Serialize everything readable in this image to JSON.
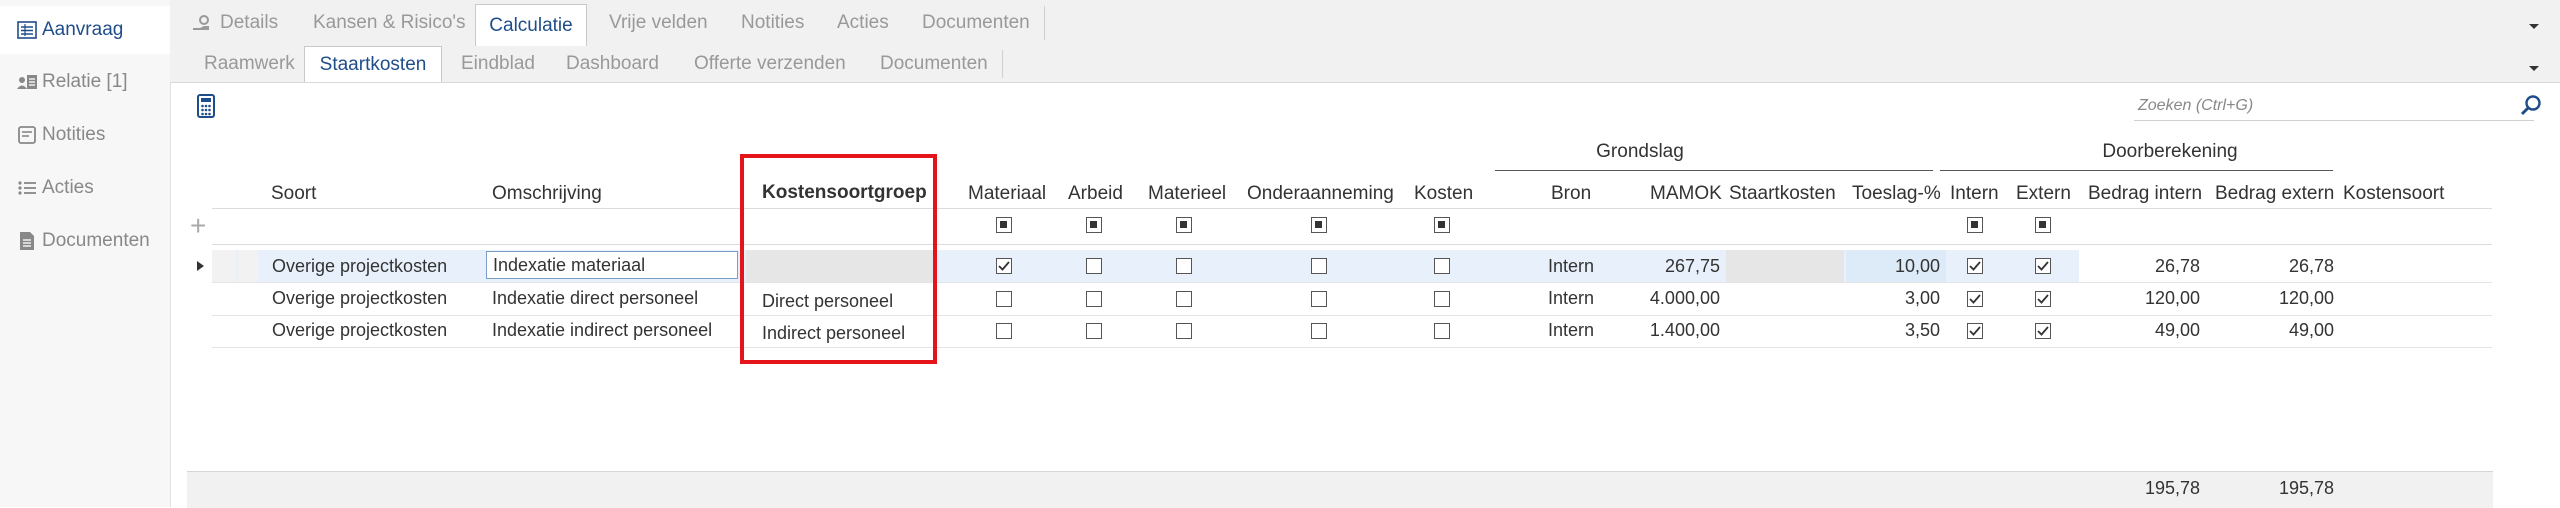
{
  "sidebar": {
    "items": [
      {
        "label": "Aanvraag",
        "icon": "form-icon",
        "active": true
      },
      {
        "label": "Relatie [1]",
        "icon": "contacts-icon",
        "active": false
      },
      {
        "label": "Notities",
        "icon": "notes-icon",
        "active": false
      },
      {
        "label": "Acties",
        "icon": "list-icon",
        "active": false
      },
      {
        "label": "Documenten",
        "icon": "document-icon",
        "active": false
      }
    ]
  },
  "tabs_primary": [
    {
      "label": "Details",
      "active": false
    },
    {
      "label": "Kansen & Risico's",
      "active": false
    },
    {
      "label": "Calculatie",
      "active": true
    },
    {
      "label": "Vrije velden",
      "active": false
    },
    {
      "label": "Notities",
      "active": false
    },
    {
      "label": "Acties",
      "active": false
    },
    {
      "label": "Documenten",
      "active": false
    }
  ],
  "tabs_secondary": [
    {
      "label": "Raamwerk",
      "active": false
    },
    {
      "label": "Staartkosten",
      "active": true
    },
    {
      "label": "Eindblad",
      "active": false
    },
    {
      "label": "Dashboard",
      "active": false
    },
    {
      "label": "Offerte verzenden",
      "active": false
    },
    {
      "label": "Documenten",
      "active": false
    }
  ],
  "search": {
    "placeholder": "Zoeken (Ctrl+G)"
  },
  "grid": {
    "group_headers": {
      "grondslag": "Grondslag",
      "doorberekening": "Doorberekening"
    },
    "columns": {
      "soort": "Soort",
      "omschrijving": "Omschrijving",
      "kostensoortgroep": "Kostensoortgroep",
      "materiaal": "Materiaal",
      "arbeid": "Arbeid",
      "materieel": "Materieel",
      "onderaanneming": "Onderaanneming",
      "kosten": "Kosten",
      "bron": "Bron",
      "mamok": "MAMOK",
      "staartkosten": "Staartkosten",
      "toeslag": "Toeslag-%",
      "intern": "Intern",
      "extern": "Extern",
      "bedrag_intern": "Bedrag intern",
      "bedrag_extern": "Bedrag extern",
      "kostensoort": "Kostensoort"
    },
    "add_row_symbol": "+",
    "rows": [
      {
        "soort": "Overige projectkosten",
        "omschrijving": "Indexatie materiaal",
        "kostensoortgroep": "",
        "materiaal": true,
        "arbeid": false,
        "materieel": false,
        "onderaanneming": false,
        "kosten": false,
        "bron": "Intern",
        "mamok": "267,75",
        "staartkosten": "",
        "toeslag": "10,00",
        "intern": true,
        "extern": true,
        "bedrag_intern": "26,78",
        "bedrag_extern": "26,78",
        "kostensoort": ""
      },
      {
        "soort": "Overige projectkosten",
        "omschrijving": "Indexatie direct personeel",
        "kostensoortgroep": "Direct personeel",
        "materiaal": false,
        "arbeid": false,
        "materieel": false,
        "onderaanneming": false,
        "kosten": false,
        "bron": "Intern",
        "mamok": "4.000,00",
        "staartkosten": "",
        "toeslag": "3,00",
        "intern": true,
        "extern": true,
        "bedrag_intern": "120,00",
        "bedrag_extern": "120,00",
        "kostensoort": ""
      },
      {
        "soort": "Overige projectkosten",
        "omschrijving": "Indexatie indirect personeel",
        "kostensoortgroep": "Indirect personeel",
        "materiaal": false,
        "arbeid": false,
        "materieel": false,
        "onderaanneming": false,
        "kosten": false,
        "bron": "Intern",
        "mamok": "1.400,00",
        "staartkosten": "",
        "toeslag": "3,50",
        "intern": true,
        "extern": true,
        "bedrag_intern": "49,00",
        "bedrag_extern": "49,00",
        "kostensoort": ""
      }
    ],
    "totals": {
      "bedrag_intern": "195,78",
      "bedrag_extern": "195,78"
    }
  },
  "colors": {
    "accent": "#1f4d8a",
    "highlight": "#e3151a",
    "selected_row": "#e8f1fb"
  }
}
